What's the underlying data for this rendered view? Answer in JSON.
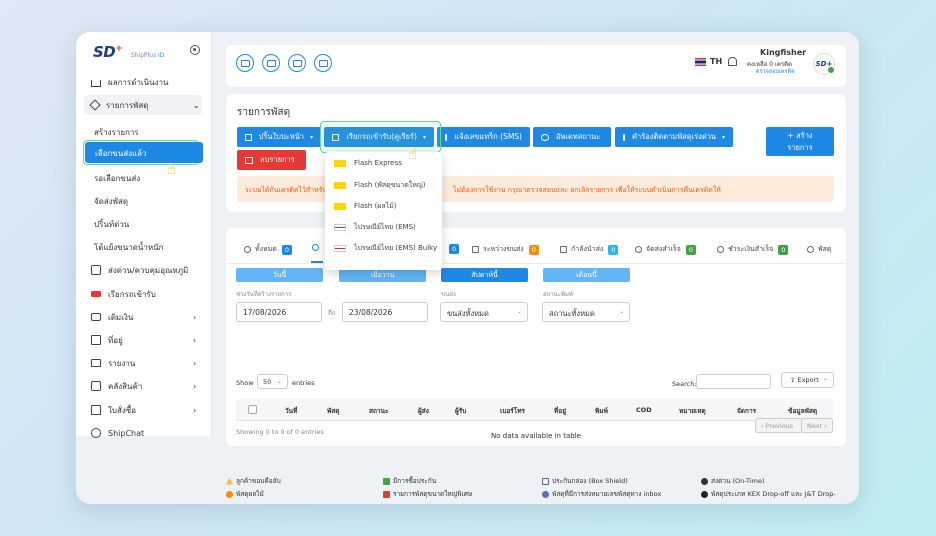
{
  "brand": {
    "logo": "SD",
    "logo_sup": "+",
    "sub": "ShipPlus ",
    "sub_accent": "ID"
  },
  "sidebar": {
    "items": [
      {
        "label": "ผลการดำเนินงาน",
        "icon": "home-icon"
      },
      {
        "label": "รายการพัสดุ",
        "icon": "box-icon"
      },
      {
        "label": "สร้างรายการ"
      },
      {
        "label": "เลือกขนส่งแล้ว"
      },
      {
        "label": "รอเลือกขนส่ง"
      },
      {
        "label": "จัดส่งพัสดุ"
      },
      {
        "label": "ปริ้นท์ด่วน"
      },
      {
        "label": "โต้แย้งขนาดน้ำหนัก"
      },
      {
        "label": "ส่งด่วน/ควบคุมอุณหภูมิ",
        "icon": "map-icon"
      },
      {
        "label": "เรียกรถเข้ารับ",
        "icon": "truck-icon"
      },
      {
        "label": "เติมเงิน",
        "icon": "wallet-icon"
      },
      {
        "label": "ที่อยู่",
        "icon": "address-icon"
      },
      {
        "label": "รายงาน",
        "icon": "folder-icon"
      },
      {
        "label": "คลังสินค้า",
        "icon": "warehouse-icon"
      },
      {
        "label": "ใบสั่งซื้อ",
        "icon": "receipt-icon"
      },
      {
        "label": "ShipChat",
        "icon": "chat-icon"
      }
    ]
  },
  "header": {
    "lang": "TH",
    "user": "Kingfisher",
    "credit": "คงเหลือ 0 เครดิต",
    "credit_link": "ตรวจสอบเครดิต"
  },
  "main": {
    "title": "รายการพัสดุ",
    "buttons": {
      "print": "ปริ้นใบปะหน้า",
      "pickup": "เรียกรถเข้ารับ(คูเรียร์)",
      "sms": "แจ้งเลขแทร็ก (SMS)",
      "update": "อัพเดทสถานะ",
      "track": "คำร้องติดตามพัสดุเร่งด่วน",
      "create_line1": "+ สร้าง",
      "create_line2": "รายการ",
      "delete": "ลบรายการ"
    },
    "alert_left": "ระบบได้กันเครดิตไว้สำหรับ",
    "alert_right": "ไม่ต้องการใช้งาน กรุณาตรวจสอบและ ยกเลิกรายการ เพื่อให้ระบบดำเนินการคืนเครดิตให้",
    "dropdown": [
      {
        "label": "Flash Express",
        "logo": "flash"
      },
      {
        "label": "Flash (พัสดุขนาดใหญ่)",
        "logo": "flash"
      },
      {
        "label": "Flash (ผลไม้)",
        "logo": "flash"
      },
      {
        "label": "ไปรษณีย์ไทย (EMS)",
        "logo": "thaipost"
      },
      {
        "label": "ไปรษณีย์ไทย (EMS) Bulky",
        "logo": "thaipost"
      }
    ]
  },
  "tabs": [
    {
      "label": "ทั้งหมด",
      "count": "0",
      "color": "#1e88e5"
    },
    {
      "label": "",
      "count": "0",
      "color": "#1e88e5"
    },
    {
      "label": "ระหว่างขนส่ง",
      "count": "0",
      "color": "#fb8c00"
    },
    {
      "label": "กำลังนำส่ง",
      "count": "0",
      "color": "#29b6f6"
    },
    {
      "label": "จัดส่งสำเร็จ",
      "count": "0",
      "color": "#43a047"
    },
    {
      "label": "ชำระเงินสำเร็จ",
      "count": "0",
      "color": "#43a047"
    },
    {
      "label": "พัสดุ",
      "count": "",
      "color": "#1e88e5"
    }
  ],
  "periods": [
    "วันนี้",
    "เมื่อวาน",
    "สัปดาห์นี้",
    "เดือนนี้"
  ],
  "filters": {
    "date_label": "ช่วงวันที่สร้างรายการ",
    "date_from": "17/08/2026",
    "to": "ถึง",
    "date_to": "23/08/2026",
    "carrier_label": "ขนส่ง",
    "carrier_value": "ขนส่งทั้งหมด",
    "status_label": "สถานะพิมพ์",
    "status_value": "สถานะทั้งหมด"
  },
  "table": {
    "show": "Show",
    "show_count": "50",
    "entries": "entries",
    "search": "Search:",
    "export": "Export",
    "headers": [
      "วันที่",
      "พัสดุ",
      "สถานะ",
      "ผู้ส่ง",
      "ผู้รับ",
      "เบอร์โทร",
      "ที่อยู่",
      "พิมพ์",
      "COD",
      "หมายเหตุ",
      "จัดการ",
      "ข้อมูลพัสดุ"
    ],
    "empty": "No data available in table",
    "info": "Showing 0 to 0 of 0 entries",
    "prev": "‹ Previous",
    "next": "Next ›"
  },
  "footer": [
    "ลูกค้าขอบคือลับ",
    "พัสดุผลไม้",
    "มีการซื้อประกัน",
    "รายการพัสดุขนาดใหญ่พิเศษ",
    "ประกันกล่อง (Box Shield)",
    "พัสดุที่มีการส่งหมายเลขพัสดุทาง inbox",
    "ส่งด่วน (On-Time)",
    "พัสดุประเภท KEX Drop-off และ J&T Drop-"
  ],
  "colors": {
    "primary": "#1e88e5",
    "danger": "#e53935",
    "highlight": "#5fd89a",
    "alert_bg": "#fdebdc"
  }
}
